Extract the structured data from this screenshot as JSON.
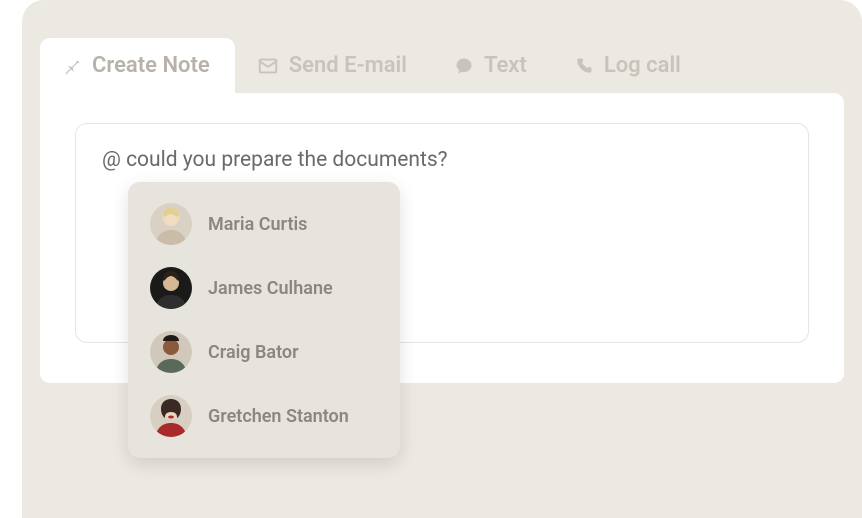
{
  "tabs": [
    {
      "label": "Create Note",
      "icon": "pin-icon",
      "active": true
    },
    {
      "label": "Send E-mail",
      "icon": "mail-icon",
      "active": false
    },
    {
      "label": "Text",
      "icon": "chat-icon",
      "active": false
    },
    {
      "label": "Log call",
      "icon": "phone-icon",
      "active": false
    }
  ],
  "note": {
    "prefix": "@",
    "text": " could you prepare the documents?"
  },
  "mentions": [
    {
      "name": "Maria Curtis"
    },
    {
      "name": "James Culhane"
    },
    {
      "name": "Craig Bator"
    },
    {
      "name": "Gretchen Stanton"
    }
  ]
}
